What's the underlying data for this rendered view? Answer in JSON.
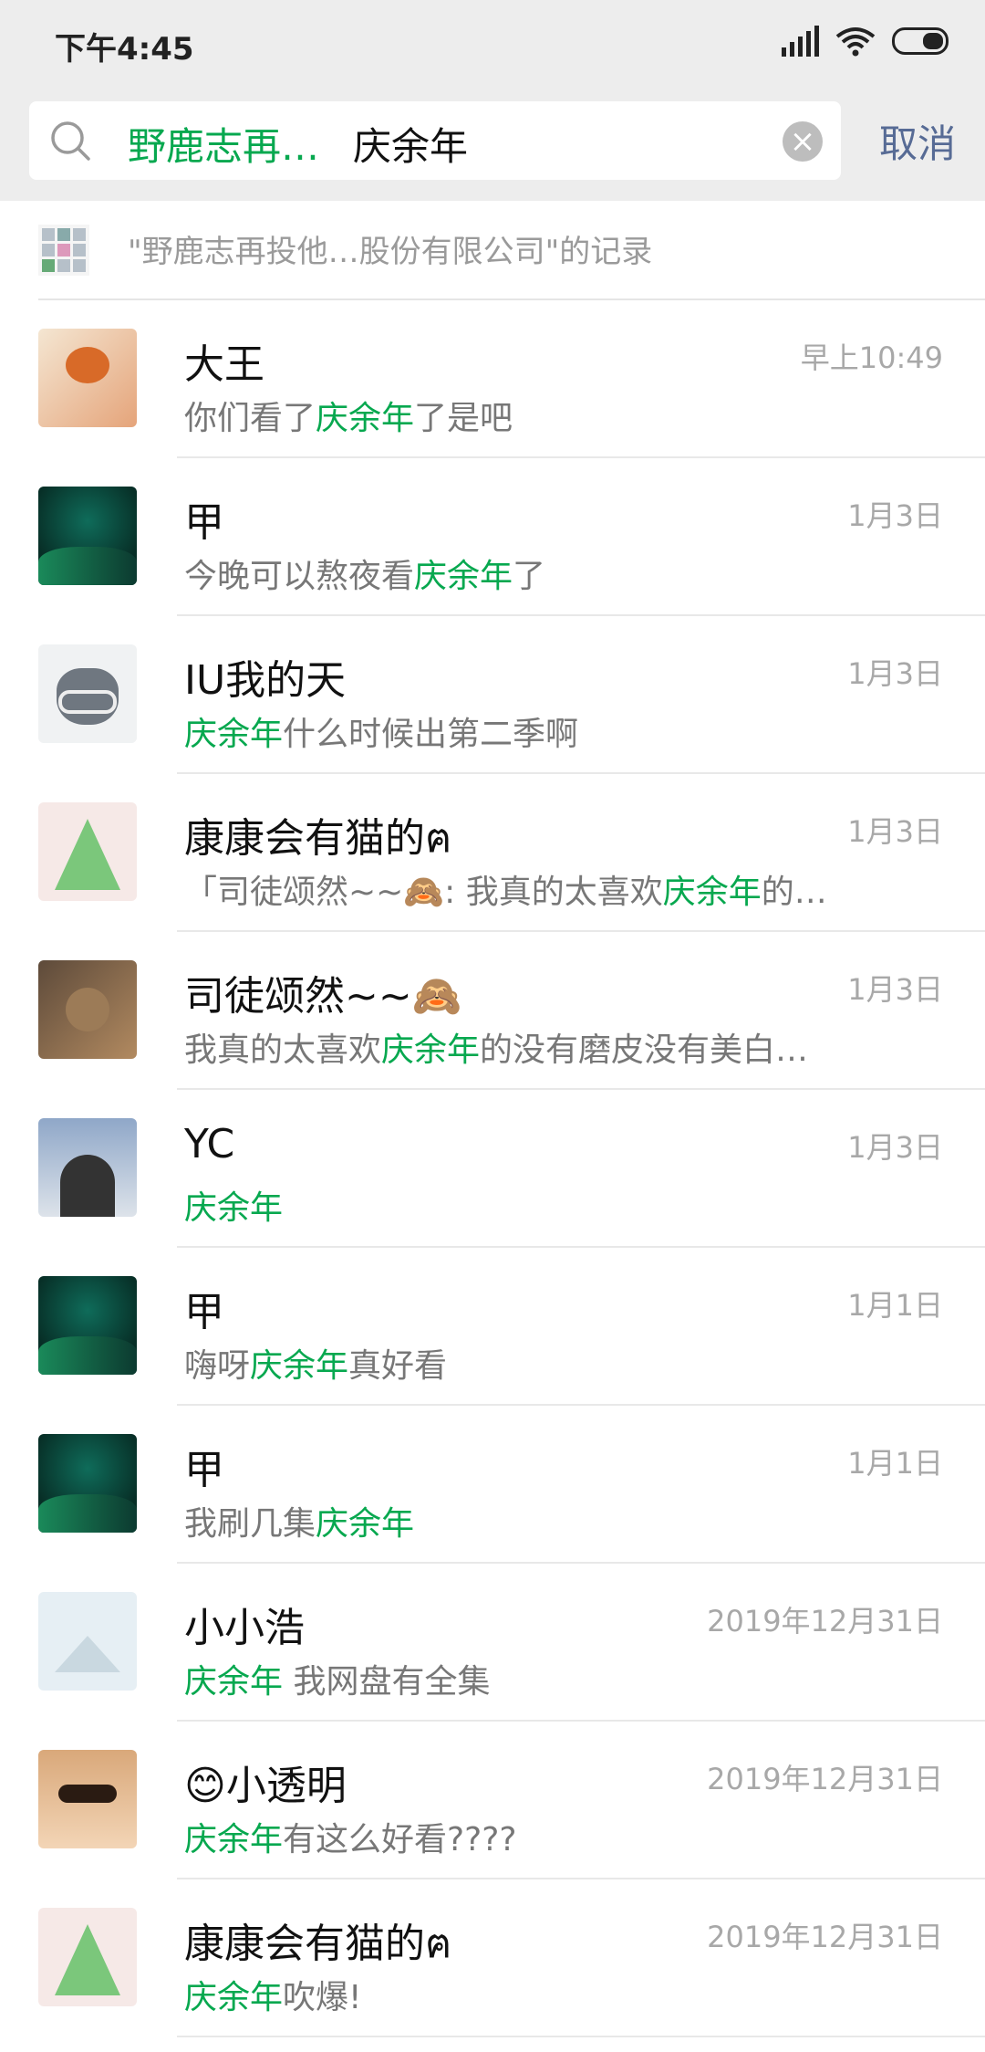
{
  "status_bar": {
    "time": "下午4:45"
  },
  "search": {
    "tag": "野鹿志再…",
    "query": "庆余年",
    "cancel_label": "取消"
  },
  "record": {
    "text": "\"野鹿志再投他…股份有限公司\"的记录"
  },
  "items": [
    {
      "name": "大王",
      "time": "早上10:49",
      "avatar": "bear",
      "pre": "你们看了",
      "hl": "庆余年",
      "post": "了是吧"
    },
    {
      "name": "甲",
      "time": "1月3日",
      "avatar": "green",
      "pre": "今晚可以熬夜看",
      "hl": "庆余年",
      "post": "了"
    },
    {
      "name": "IU我的天",
      "time": "1月3日",
      "avatar": "cat",
      "pre": "",
      "hl": "庆余年",
      "post": "什么时候出第二季啊"
    },
    {
      "name": "康康会有猫的ฅ",
      "time": "1月3日",
      "avatar": "tree",
      "pre": "「司徒颂然~~🙈: 我真的太喜欢",
      "hl": "庆余年",
      "post": "的…"
    },
    {
      "name": "司徒颂然~~🙈",
      "time": "1月3日",
      "avatar": "tabby",
      "pre": "我真的太喜欢",
      "hl": "庆余年",
      "post": "的没有磨皮没有美白…"
    },
    {
      "name": "YC",
      "time": "1月3日",
      "avatar": "person",
      "pre": "",
      "hl": "庆余年",
      "post": ""
    },
    {
      "name": "甲",
      "time": "1月1日",
      "avatar": "green",
      "pre": "嗨呀",
      "hl": "庆余年",
      "post": "真好看"
    },
    {
      "name": "甲",
      "time": "1月1日",
      "avatar": "green",
      "pre": "我刷几集",
      "hl": "庆余年",
      "post": ""
    },
    {
      "name": "小小浩",
      "time": "2019年12月31日",
      "avatar": "placeholder",
      "pre": "",
      "hl": "庆余年",
      "post": " 我网盘有全集"
    },
    {
      "name": "😊小透明",
      "time": "2019年12月31日",
      "avatar": "kid",
      "pre": "",
      "hl": "庆余年",
      "post": "有这么好看????"
    },
    {
      "name": "康康会有猫的ฅ",
      "time": "2019年12月31日",
      "avatar": "tree",
      "pre": "",
      "hl": "庆余年",
      "post": "吹爆!"
    }
  ]
}
